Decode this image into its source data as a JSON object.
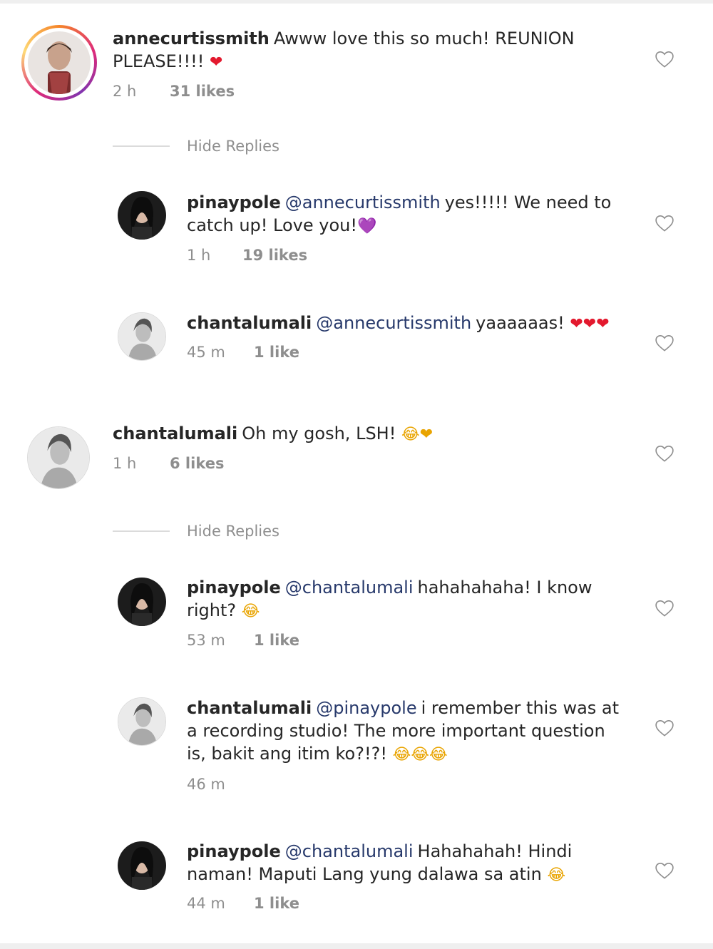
{
  "icons": {
    "like": "heart-outline-icon",
    "heart_emoji": "❤️",
    "purple_heart_emoji": "💜",
    "laugh_emoji": "😂"
  },
  "colors": {
    "mention": "#27396b",
    "muted": "#8e8e8e",
    "text": "#262626",
    "heart": "#e3192e"
  },
  "comments": [
    {
      "username": "annecurtissmith",
      "text": "Awww love this so much! REUNION PLEASE!!!!",
      "emojis": "❤",
      "time": "2 h",
      "likes": "31 likes",
      "hide_replies": "Hide Replies",
      "replies": [
        {
          "username": "pinaypole",
          "mention": "@annecurtissmith",
          "text": "yes!!!!! We need to catch up! Love you!",
          "emojis": "💜",
          "time": "1 h",
          "likes": "19 likes"
        },
        {
          "username": "chantalumali",
          "mention": "@annecurtissmith",
          "text": "yaaaaaas!",
          "emojis": "❤❤❤",
          "time": "45 m",
          "likes": "1 like"
        }
      ]
    },
    {
      "username": "chantalumali",
      "text": "Oh my gosh, LSH!",
      "emojis": "😂❤",
      "time": "1 h",
      "likes": "6 likes",
      "hide_replies": "Hide Replies",
      "replies": [
        {
          "username": "pinaypole",
          "mention": "@chantalumali",
          "text": "hahahahaha! I know right?",
          "emojis": "😂",
          "time": "53 m",
          "likes": "1 like"
        },
        {
          "username": "chantalumali",
          "mention": "@pinaypole",
          "text": "i remember this was at a recording studio! The more important question is, bakit ang itim ko?!?!",
          "emojis": "😂😂😂",
          "time": "46 m",
          "likes": ""
        },
        {
          "username": "pinaypole",
          "mention": "@chantalumali",
          "text": "Hahahahah! Hindi naman! Maputi Lang yung dalawa sa atin",
          "emojis": "😂",
          "time": "44 m",
          "likes": "1 like"
        }
      ]
    }
  ]
}
